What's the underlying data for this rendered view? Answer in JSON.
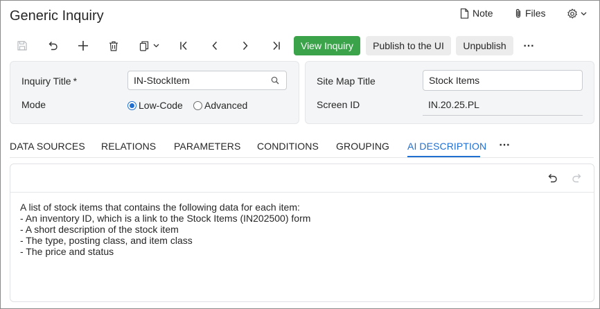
{
  "window": {
    "title": "Generic Inquiry"
  },
  "topbar": {
    "note_label": "Note",
    "files_label": "Files"
  },
  "toolbar": {
    "view_inquiry": "View Inquiry",
    "publish": "Publish to the UI",
    "unpublish": "Unpublish",
    "more": "⋯"
  },
  "form_left": {
    "inquiry_title_label": "Inquiry Title",
    "required_mark": "*",
    "inquiry_title_value": "IN-StockItem",
    "mode_label": "Mode",
    "mode_options": [
      "Low-Code",
      "Advanced"
    ],
    "mode_selected": "Low-Code"
  },
  "form_right": {
    "site_map_title_label": "Site Map Title",
    "site_map_title_value": "Stock Items",
    "screen_id_label": "Screen ID",
    "screen_id_value": "IN.20.25.PL"
  },
  "tabs": [
    {
      "label": "DATA SOURCES"
    },
    {
      "label": "RELATIONS"
    },
    {
      "label": "PARAMETERS"
    },
    {
      "label": "CONDITIONS"
    },
    {
      "label": "GROUPING"
    },
    {
      "label": "AI DESCRIPTION",
      "active": true
    }
  ],
  "tabs_more": "⋯",
  "editor": {
    "lines": [
      "A list of stock items that contains the following data for each item:",
      "- An inventory ID, which is a link to the Stock Items (IN202500) form",
      "- A short description of the stock item",
      "- The type, posting class, and item class",
      "- The price and status"
    ]
  },
  "colors": {
    "accent": "#1f6fd1",
    "primary_button": "#3ba34a"
  }
}
